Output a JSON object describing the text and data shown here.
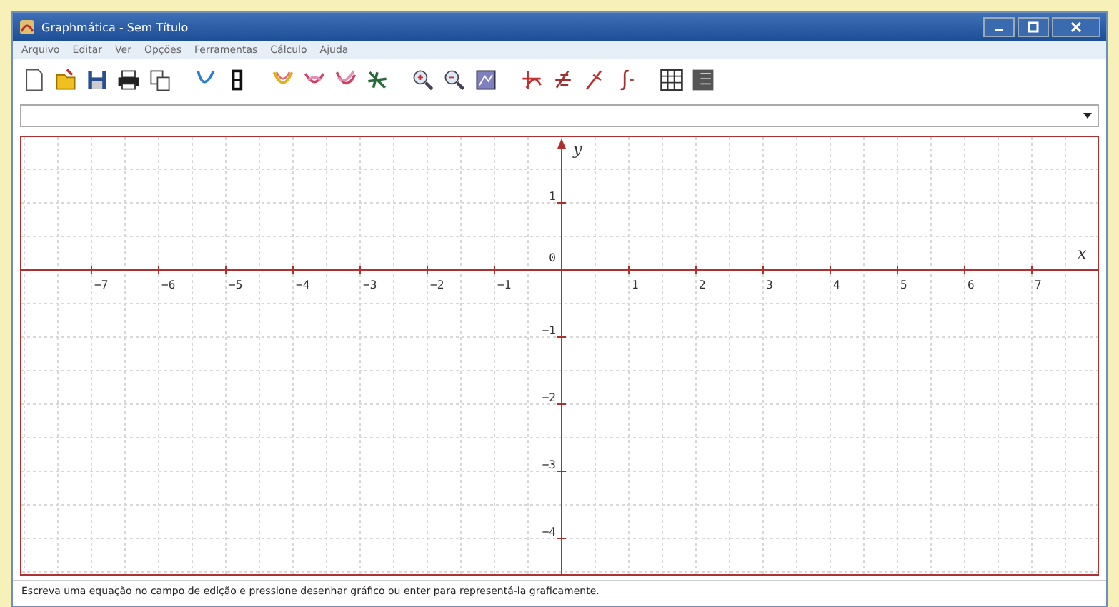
{
  "window": {
    "title": "Graphmática - Sem Título"
  },
  "menu": [
    "Arquivo",
    "Editar",
    "Ver",
    "Opções",
    "Ferramentas",
    "Cálculo",
    "Ajuda"
  ],
  "graph": {
    "x_label": "x",
    "y_label": "y",
    "origin_label": "0",
    "x_ticks": [
      "−7",
      "−6",
      "−5",
      "−4",
      "−3",
      "−2",
      "−1",
      "1",
      "2",
      "3",
      "4",
      "5",
      "6",
      "7"
    ],
    "y_ticks": [
      "1",
      "−1",
      "−2",
      "−3",
      "−4"
    ]
  },
  "status_bar": "Escreva uma equação no campo de edição e pressione desenhar gráfico ou enter para representá-la graficamente."
}
